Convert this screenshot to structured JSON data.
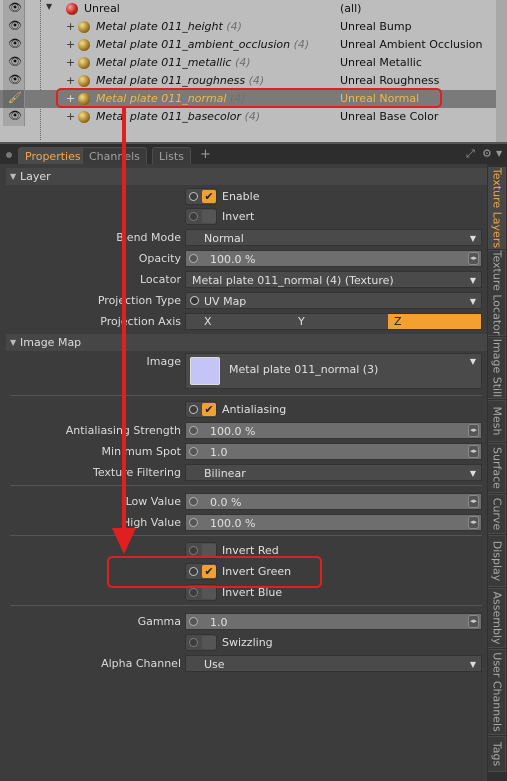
{
  "tree": {
    "rows": [
      {
        "name": "Unreal",
        "count": "",
        "effect": "(all)"
      },
      {
        "name": "Metal plate 011_height",
        "count": "(4)",
        "effect": "Unreal Bump"
      },
      {
        "name": "Metal plate 011_ambient_occlusion",
        "count": "(4)",
        "effect": "Unreal Ambient Occlusion"
      },
      {
        "name": "Metal plate 011_metallic",
        "count": "(4)",
        "effect": "Unreal Metallic"
      },
      {
        "name": "Metal plate 011_roughness",
        "count": "(4)",
        "effect": "Unreal Roughness"
      },
      {
        "name": "Metal plate 011_normal",
        "count": "(4)",
        "effect": "Unreal Normal"
      },
      {
        "name": "Metal plate 011_basecolor",
        "count": "(4)",
        "effect": "Unreal Base Color"
      }
    ]
  },
  "tabs": {
    "properties": "Properties",
    "channels": "Channels",
    "lists": "Lists",
    "add": "+"
  },
  "vertical_tabs": [
    "Texture Layers",
    "Texture Locator",
    "Image Still",
    "Mesh",
    "Surface",
    "Curve",
    "Display",
    "Assembly",
    "User Channels",
    "Tags"
  ],
  "layer": {
    "header": "Layer",
    "enable": "Enable",
    "invert": "Invert",
    "blend_mode_label": "Blend Mode",
    "blend_mode": "Normal",
    "opacity_label": "Opacity",
    "opacity": "100.0 %",
    "locator_label": "Locator",
    "locator": "Metal plate 011_normal (4) (Texture)",
    "projection_type_label": "Projection Type",
    "projection_type": "UV Map",
    "projection_axis_label": "Projection Axis",
    "axis_x": "X",
    "axis_y": "Y",
    "axis_z": "Z"
  },
  "image_map": {
    "header": "Image Map",
    "image_label": "Image",
    "image": "Metal plate 011_normal (3)",
    "antialiasing": "Antialiasing",
    "aa_strength_label": "Antialiasing Strength",
    "aa_strength": "100.0 %",
    "min_spot_label": "Minimum Spot",
    "min_spot": "1.0",
    "tex_filter_label": "Texture Filtering",
    "tex_filter": "Bilinear",
    "low_value_label": "Low Value",
    "low_value": "0.0 %",
    "high_value_label": "High Value",
    "high_value": "100.0 %",
    "invert_red": "Invert Red",
    "invert_green": "Invert Green",
    "invert_blue": "Invert Blue",
    "gamma_label": "Gamma",
    "gamma": "1.0",
    "swizzling": "Swizzling",
    "alpha_channel_label": "Alpha Channel",
    "alpha_channel": "Use"
  },
  "colors": {
    "accent": "#f2a030",
    "selection_text": "#f2b64a",
    "annotation": "#e02020"
  }
}
